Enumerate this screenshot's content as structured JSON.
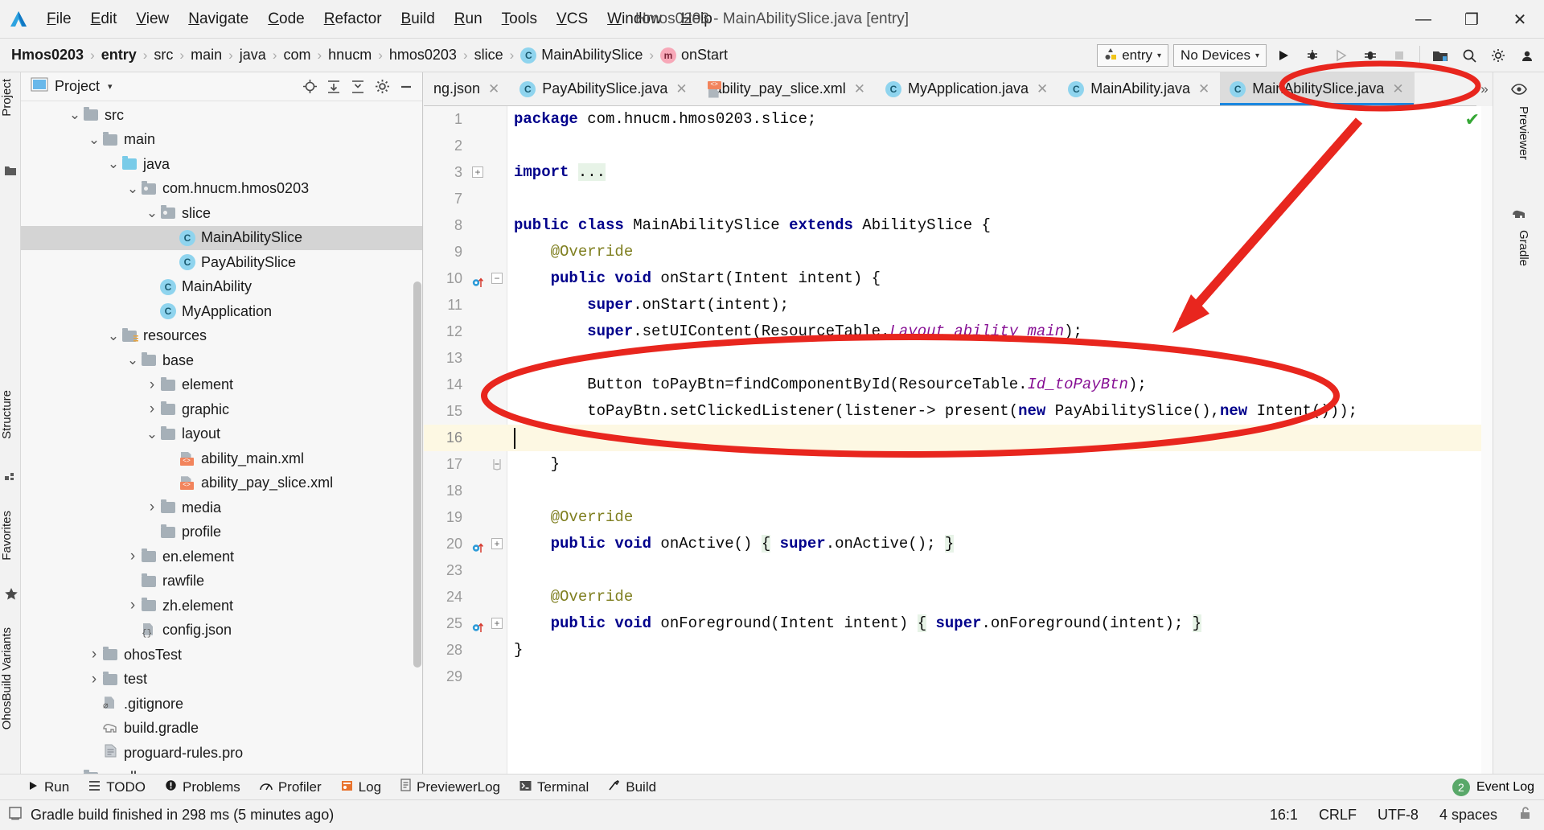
{
  "window": {
    "title": "Hmos0203 - MainAbilitySlice.java [entry]",
    "minimize": "—",
    "maximize": "❐",
    "close": "✕"
  },
  "menu": {
    "items": [
      "File",
      "Edit",
      "View",
      "Navigate",
      "Code",
      "Refactor",
      "Build",
      "Run",
      "Tools",
      "VCS",
      "Window",
      "Help"
    ]
  },
  "breadcrumb": {
    "items": [
      {
        "label": "Hmos0203",
        "bold": true,
        "badge": ""
      },
      {
        "label": "entry",
        "bold": true,
        "badge": ""
      },
      {
        "label": "src",
        "bold": false,
        "badge": ""
      },
      {
        "label": "main",
        "bold": false,
        "badge": ""
      },
      {
        "label": "java",
        "bold": false,
        "badge": ""
      },
      {
        "label": "com",
        "bold": false,
        "badge": ""
      },
      {
        "label": "hnucm",
        "bold": false,
        "badge": ""
      },
      {
        "label": "hmos0203",
        "bold": false,
        "badge": ""
      },
      {
        "label": "slice",
        "bold": false,
        "badge": ""
      },
      {
        "label": "MainAbilitySlice",
        "bold": false,
        "badge": "C"
      },
      {
        "label": "onStart",
        "bold": false,
        "badge": "m"
      }
    ],
    "separator": "›"
  },
  "toolbar": {
    "run_config": "entry",
    "device": "No Devices",
    "caret": "▾",
    "icons": [
      {
        "name": "run-icon",
        "glyph": "▶"
      },
      {
        "name": "debug-icon",
        "glyph": "⚙"
      },
      {
        "name": "run-coverage-icon",
        "glyph": "◑"
      },
      {
        "name": "profile-icon",
        "glyph": "☸"
      },
      {
        "name": "stop-icon",
        "glyph": "■"
      },
      {
        "name": "device-manager-icon",
        "glyph": "☰"
      },
      {
        "name": "search-everywhere-icon",
        "glyph": "⚲"
      },
      {
        "name": "settings-icon",
        "glyph": "⚙"
      },
      {
        "name": "account-icon",
        "glyph": "●"
      }
    ]
  },
  "left_strip": {
    "project_label": "Project",
    "structure_label": "Structure",
    "favorites_label": "Favorites",
    "build_variants_label": "OhosBuild Variants"
  },
  "project_panel": {
    "title": "Project",
    "caret": "▾",
    "header_icons": [
      "locate-icon",
      "expand-all-icon",
      "collapse-all-icon",
      "gear-icon",
      "hide-icon"
    ],
    "tree": [
      {
        "label": "src",
        "depth": 2,
        "twisty": "down",
        "icon": "folder",
        "selected": false
      },
      {
        "label": "main",
        "depth": 3,
        "twisty": "down",
        "icon": "folder",
        "selected": false
      },
      {
        "label": "java",
        "depth": 4,
        "twisty": "down",
        "icon": "folder-blue",
        "selected": false
      },
      {
        "label": "com.hnucm.hmos0203",
        "depth": 5,
        "twisty": "down",
        "icon": "package",
        "selected": false
      },
      {
        "label": "slice",
        "depth": 6,
        "twisty": "down",
        "icon": "package",
        "selected": false
      },
      {
        "label": "MainAbilitySlice",
        "depth": 7,
        "twisty": "none",
        "icon": "class",
        "selected": true
      },
      {
        "label": "PayAbilitySlice",
        "depth": 7,
        "twisty": "none",
        "icon": "class",
        "selected": false
      },
      {
        "label": "MainAbility",
        "depth": 6,
        "twisty": "none",
        "icon": "class",
        "selected": false
      },
      {
        "label": "MyApplication",
        "depth": 6,
        "twisty": "none",
        "icon": "class",
        "selected": false
      },
      {
        "label": "resources",
        "depth": 4,
        "twisty": "down",
        "icon": "folder-res",
        "selected": false
      },
      {
        "label": "base",
        "depth": 5,
        "twisty": "down",
        "icon": "folder",
        "selected": false
      },
      {
        "label": "element",
        "depth": 6,
        "twisty": "right",
        "icon": "folder",
        "selected": false
      },
      {
        "label": "graphic",
        "depth": 6,
        "twisty": "right",
        "icon": "folder",
        "selected": false
      },
      {
        "label": "layout",
        "depth": 6,
        "twisty": "down",
        "icon": "folder",
        "selected": false
      },
      {
        "label": "ability_main.xml",
        "depth": 7,
        "twisty": "none",
        "icon": "xml",
        "selected": false
      },
      {
        "label": "ability_pay_slice.xml",
        "depth": 7,
        "twisty": "none",
        "icon": "xml",
        "selected": false
      },
      {
        "label": "media",
        "depth": 6,
        "twisty": "right",
        "icon": "folder",
        "selected": false
      },
      {
        "label": "profile",
        "depth": 6,
        "twisty": "none",
        "icon": "folder",
        "selected": false
      },
      {
        "label": "en.element",
        "depth": 5,
        "twisty": "right",
        "icon": "folder",
        "selected": false
      },
      {
        "label": "rawfile",
        "depth": 5,
        "twisty": "none",
        "icon": "folder",
        "selected": false
      },
      {
        "label": "zh.element",
        "depth": 5,
        "twisty": "right",
        "icon": "folder",
        "selected": false
      },
      {
        "label": "config.json",
        "depth": 5,
        "twisty": "none",
        "icon": "json",
        "selected": false
      },
      {
        "label": "ohosTest",
        "depth": 3,
        "twisty": "right",
        "icon": "folder",
        "selected": false
      },
      {
        "label": "test",
        "depth": 3,
        "twisty": "right",
        "icon": "folder",
        "selected": false
      },
      {
        "label": ".gitignore",
        "depth": 3,
        "twisty": "none",
        "icon": "gitignore",
        "selected": false
      },
      {
        "label": "build.gradle",
        "depth": 3,
        "twisty": "none",
        "icon": "gradle",
        "selected": false
      },
      {
        "label": "proguard-rules.pro",
        "depth": 3,
        "twisty": "none",
        "icon": "file",
        "selected": false
      },
      {
        "label": "gradle",
        "depth": 2,
        "twisty": "right",
        "icon": "folder",
        "selected": false
      }
    ]
  },
  "editor_tabs": {
    "close_glyph": "✕",
    "overflow_glyph": "»",
    "items": [
      {
        "label": "ng.json",
        "icon": "json-icon",
        "active": false,
        "truncated": true
      },
      {
        "label": "PayAbilitySlice.java",
        "icon": "class-icon",
        "active": false,
        "truncated": false
      },
      {
        "label": "ability_pay_slice.xml",
        "icon": "xml-icon",
        "active": false,
        "truncated": false
      },
      {
        "label": "MyApplication.java",
        "icon": "class-icon",
        "active": false,
        "truncated": false
      },
      {
        "label": "MainAbility.java",
        "icon": "class-icon",
        "active": false,
        "truncated": false
      },
      {
        "label": "MainAbilitySlice.java",
        "icon": "class-icon",
        "active": true,
        "truncated": false
      }
    ]
  },
  "code": {
    "inspection_status": "✔",
    "lines": [
      {
        "num": "1",
        "html": "<span class=\"kw\">package</span> com.hnucm.hmos0203.slice;",
        "gutter": "",
        "fold": "",
        "hl": false
      },
      {
        "num": "2",
        "html": "",
        "gutter": "",
        "fold": "",
        "hl": false
      },
      {
        "num": "3",
        "html": "<span class=\"kw\">import</span> <span class=\"greenbg\">...</span>",
        "gutter": "",
        "fold": "plus-left",
        "hl": false
      },
      {
        "num": "7",
        "html": "",
        "gutter": "",
        "fold": "",
        "hl": false
      },
      {
        "num": "8",
        "html": "<span class=\"kw\">public class</span> MainAbilitySlice <span class=\"kw\">extends</span> AbilitySlice {",
        "gutter": "",
        "fold": "",
        "hl": false
      },
      {
        "num": "9",
        "html": "    <span class=\"ann\">@Override</span>",
        "gutter": "",
        "fold": "",
        "hl": false
      },
      {
        "num": "10",
        "html": "    <span class=\"kw\">public void</span> onStart(Intent intent) {",
        "gutter": "override",
        "fold": "minus",
        "hl": false
      },
      {
        "num": "11",
        "html": "        <span class=\"kw\">super</span>.onStart(intent);",
        "gutter": "",
        "fold": "",
        "hl": false
      },
      {
        "num": "12",
        "html": "        <span class=\"kw\">super</span>.setUIContent(ResourceTable.<span class=\"fld\">Layout_ability_main</span>);",
        "gutter": "",
        "fold": "",
        "hl": false
      },
      {
        "num": "13",
        "html": "",
        "gutter": "",
        "fold": "",
        "hl": false
      },
      {
        "num": "14",
        "html": "        Button toPayBtn=findComponentById(ResourceTable.<span class=\"fld\">Id_toPayBtn</span>);",
        "gutter": "",
        "fold": "",
        "hl": false
      },
      {
        "num": "15",
        "html": "        toPayBtn.setClickedListener(listener-&gt; present(<span class=\"kw\">new</span> PayAbilitySlice(),<span class=\"kw\">new</span> Intent()));",
        "gutter": "",
        "fold": "",
        "hl": false
      },
      {
        "num": "16",
        "html": "",
        "gutter": "",
        "fold": "",
        "hl": true,
        "caret": true
      },
      {
        "num": "17",
        "html": "    }",
        "gutter": "",
        "fold": "end",
        "hl": false
      },
      {
        "num": "18",
        "html": "",
        "gutter": "",
        "fold": "",
        "hl": false
      },
      {
        "num": "19",
        "html": "    <span class=\"ann\">@Override</span>",
        "gutter": "",
        "fold": "",
        "hl": false
      },
      {
        "num": "20",
        "html": "    <span class=\"kw\">public void</span> onActive() <span class=\"greenbg\">{</span> <span class=\"kw\">super</span>.onActive(); <span class=\"greenbg\">}</span>",
        "gutter": "override",
        "fold": "plus",
        "hl": false
      },
      {
        "num": "23",
        "html": "",
        "gutter": "",
        "fold": "",
        "hl": false
      },
      {
        "num": "24",
        "html": "    <span class=\"ann\">@Override</span>",
        "gutter": "",
        "fold": "",
        "hl": false
      },
      {
        "num": "25",
        "html": "    <span class=\"kw\">public void</span> onForeground(Intent intent) <span class=\"greenbg\">{</span> <span class=\"kw\">super</span>.onForeground(intent); <span class=\"greenbg\">}</span>",
        "gutter": "override",
        "fold": "plus",
        "hl": false
      },
      {
        "num": "28",
        "html": "}",
        "gutter": "",
        "fold": "",
        "hl": false
      },
      {
        "num": "29",
        "html": "",
        "gutter": "",
        "fold": "",
        "hl": false
      }
    ]
  },
  "right_strip": {
    "previewer_label": "Previewer",
    "gradle_label": "Gradle"
  },
  "bottom_bar": {
    "items": [
      {
        "label": "Run",
        "icon": "run-icon"
      },
      {
        "label": "TODO",
        "icon": "todo-icon"
      },
      {
        "label": "Problems",
        "icon": "problems-icon"
      },
      {
        "label": "Profiler",
        "icon": "profiler-icon"
      },
      {
        "label": "Log",
        "icon": "log-icon"
      },
      {
        "label": "PreviewerLog",
        "icon": "previewer-log-icon"
      },
      {
        "label": "Terminal",
        "icon": "terminal-icon"
      },
      {
        "label": "Build",
        "icon": "build-icon"
      }
    ],
    "event_log_label": "Event Log",
    "event_log_count": "2"
  },
  "status_bar": {
    "message": "Gradle build finished in 298 ms (5 minutes ago)",
    "caret_position": "16:1",
    "line_separator": "CRLF",
    "encoding": "UTF-8",
    "indent": "4 spaces"
  },
  "colors": {
    "annotation_red": "#e8261e",
    "accent_blue": "#1a87e0",
    "selection_gray": "#d4d4d4",
    "highlight_line": "#fdf8e3",
    "keyword": "#00008b",
    "field": "#871094",
    "annotation_text": "#7f7f20"
  }
}
